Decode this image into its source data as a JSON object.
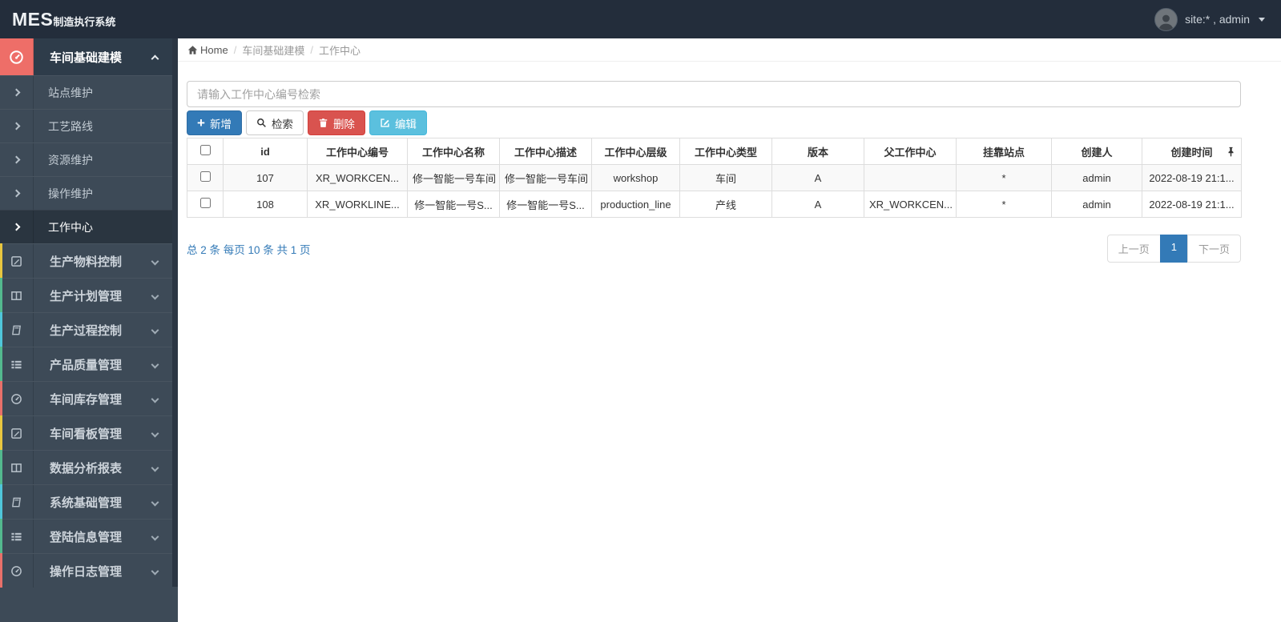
{
  "header": {
    "brand_bold": "MES",
    "brand_rest": "制造执行系统",
    "user_label": "site:* , admin"
  },
  "breadcrumb": {
    "home": "Home",
    "sep": "/",
    "level1": "车间基础建模",
    "level2": "工作中心"
  },
  "sidebar": {
    "group_active": {
      "label": "车间基础建模",
      "icon": "tachometer-icon",
      "icon_bg": "#ee6e68"
    },
    "submenu": [
      {
        "label": "站点维护"
      },
      {
        "label": "工艺路线"
      },
      {
        "label": "资源维护"
      },
      {
        "label": "操作维护"
      },
      {
        "label": "工作中心",
        "active": true
      }
    ],
    "groups": [
      {
        "label": "生产物料控制",
        "icon": "pencil-square-icon",
        "accent": "#e8c63f"
      },
      {
        "label": "生产计划管理",
        "icon": "columns-icon",
        "accent": "#53b98e"
      },
      {
        "label": "生产过程控制",
        "icon": "book-icon",
        "accent": "#4fc6da"
      },
      {
        "label": "产品质量管理",
        "icon": "th-list-icon",
        "accent": "#53b98e"
      },
      {
        "label": "车间库存管理",
        "icon": "tachometer-icon",
        "accent": "#e8706a"
      },
      {
        "label": "车间看板管理",
        "icon": "pencil-square-icon",
        "accent": "#e8c63f"
      },
      {
        "label": "数据分析报表",
        "icon": "columns-icon",
        "accent": "#53b98e"
      },
      {
        "label": "系统基础管理",
        "icon": "book-icon",
        "accent": "#4fc6da"
      },
      {
        "label": "登陆信息管理",
        "icon": "th-list-icon",
        "accent": "#53b98e"
      },
      {
        "label": "操作日志管理",
        "icon": "tachometer-icon",
        "accent": "#e8706a"
      }
    ]
  },
  "toolbar": {
    "search_placeholder": "请输入工作中心编号检索",
    "add_label": "新增",
    "search_label": "检索",
    "delete_label": "删除",
    "edit_label": "编辑"
  },
  "table": {
    "columns": [
      "id",
      "工作中心编号",
      "工作中心名称",
      "工作中心描述",
      "工作中心层级",
      "工作中心类型",
      "版本",
      "父工作中心",
      "挂靠站点",
      "创建人",
      "创建时间"
    ],
    "rows": [
      {
        "id": "107",
        "code": "XR_WORKCEN...",
        "name": "修一智能一号车间",
        "desc": "修一智能一号车间",
        "level": "workshop",
        "type": "车间",
        "version": "A",
        "parent": "",
        "station": "*",
        "creator": "admin",
        "created": "2022-08-19 21:1..."
      },
      {
        "id": "108",
        "code": "XR_WORKLINE...",
        "name": "修一智能一号S...",
        "desc": "修一智能一号S...",
        "level": "production_line",
        "type": "产线",
        "version": "A",
        "parent": "XR_WORKCEN...",
        "station": "*",
        "creator": "admin",
        "created": "2022-08-19 21:1..."
      }
    ]
  },
  "pagination": {
    "summary": "总 2 条  每页 10 条  共 1 页",
    "prev": "上一页",
    "current": "1",
    "next": "下一页"
  },
  "colors": {
    "header_bg": "#232d3b",
    "sidebar_bg": "#3d4a57",
    "active_group_bg": "#2e3c4a",
    "active_group_icon_bg": "#ee6e68",
    "primary": "#337ab7",
    "danger": "#d9534f",
    "info": "#5bc0de",
    "link": "#337ab7",
    "table_border": "#dddddd",
    "stripe": "#f9f9f9"
  }
}
